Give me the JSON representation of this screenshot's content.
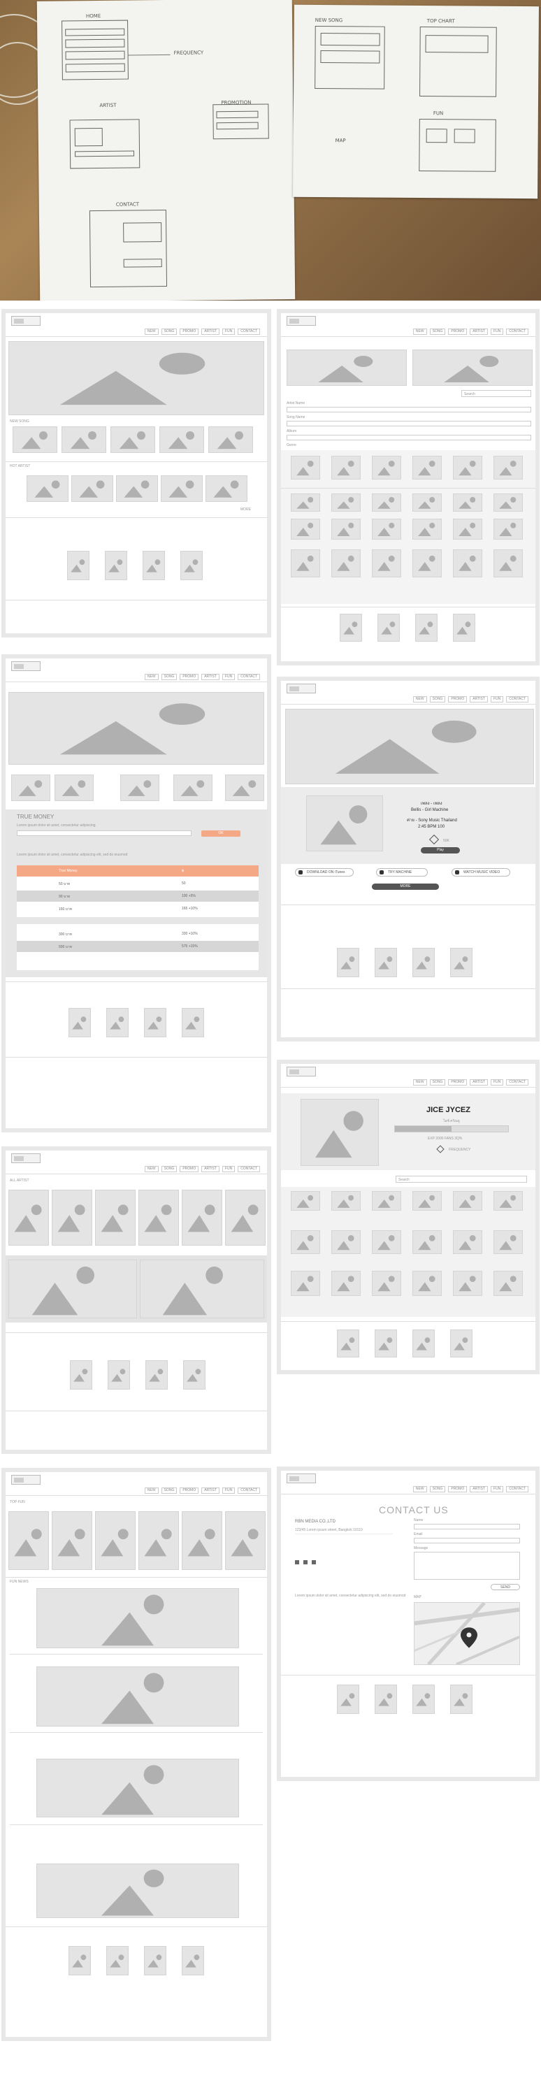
{
  "photo": {
    "sketch1_labels": [
      "HOME",
      "FREQUENCY",
      "ARTIST",
      "PROMOTION",
      "CONTACT"
    ],
    "sketch2_labels": [
      "NEW SONG",
      "TOP CHART",
      "FUN"
    ],
    "sketch3_labels": [
      "MAP"
    ]
  },
  "nav_items": [
    "NEW",
    "SONG",
    "PROMO",
    "ARTIST",
    "FUN",
    "CONTACT"
  ],
  "home": {
    "row_label": "NEW SONG",
    "row2_label": "HOT ARTIST",
    "more": "MORE"
  },
  "promo": {
    "title": "TRUE MONEY",
    "desc": "Lorem ipsum dolor sit amet, consectetur adipiscing",
    "button": "OK",
    "note": "Lorem ipsum dolor sit amet, consectetur adipiscing elit, sed do eiusmod",
    "table_head": [
      "True Money",
      "฿"
    ],
    "table_rows": [
      [
        "50 บาท",
        "50"
      ],
      [
        "90 บาท",
        "100 +5%"
      ],
      [
        "150 บาท",
        "165 +10%"
      ],
      [
        "300 บาท",
        "330 +10%"
      ],
      [
        "500 บาท",
        "575 +15%"
      ]
    ]
  },
  "song_list": {
    "filter": "Search",
    "rows": [
      "Artist Name",
      "Song Name",
      "Album",
      "Genre"
    ]
  },
  "song_detail": {
    "line1": "เพลง - เพลง",
    "line2": "Bellis - Girl Machine",
    "line3": "ค่าย - Sony Music Thailand",
    "line4": "2:45 BPM 100",
    "share": "50K",
    "play": "Play",
    "actions": [
      "DOWNLOAD ON iTunes",
      "TRY MACHINE",
      "WATCH MUSIC VIDEO"
    ],
    "download": "MORE"
  },
  "artist": {
    "name": "JICE JYCEZ",
    "sub": "ไอซ์ ศรัณยู",
    "followers": "EXP 2000 FANS 3Q%",
    "rank": "FREQUENCY",
    "filter": "Search"
  },
  "gallery": {
    "label": "ALL ARTIST"
  },
  "fun": {
    "labels": [
      "TOP FUN",
      "FUN NEWS"
    ]
  },
  "contact": {
    "title": "CONTACT US",
    "company": "RBN MEDIA CO.,LTD",
    "address": "123/45 Lorem ipsum street, Bangkok 10110",
    "fields": [
      "Name",
      "Email",
      "Message"
    ],
    "send": "SEND",
    "map_label": "MAP"
  }
}
